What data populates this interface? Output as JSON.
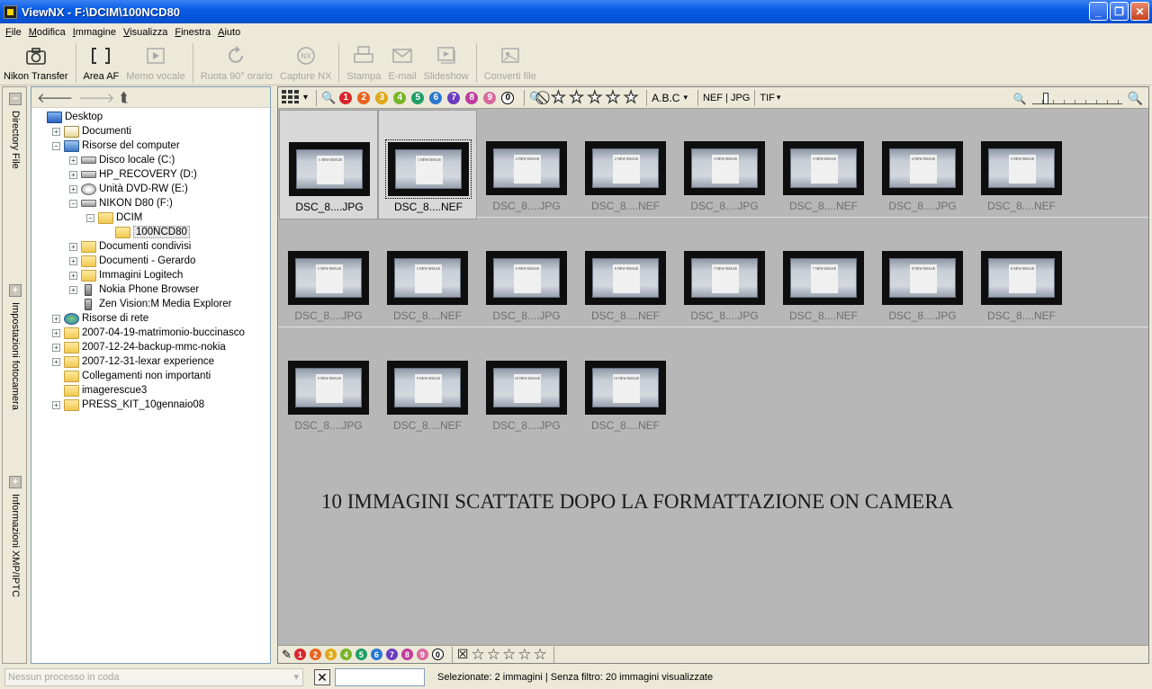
{
  "window": {
    "title": "ViewNX - F:\\DCIM\\100NCD80"
  },
  "menu": [
    "File",
    "Modifica",
    "Immagine",
    "Visualizza",
    "Finestra",
    "Aiuto"
  ],
  "toolbar": [
    {
      "label": "Nikon Transfer",
      "icon": "camera-icon",
      "enabled": true
    },
    {
      "label": "Area AF",
      "icon": "af-brackets-icon",
      "enabled": true
    },
    {
      "label": "Memo vocale",
      "icon": "play-icon",
      "enabled": false
    },
    {
      "label": "Ruota 90° orario",
      "icon": "rotate-icon",
      "enabled": false
    },
    {
      "label": "Capture NX",
      "icon": "capture-nx-icon",
      "enabled": false
    },
    {
      "label": "Stampa",
      "icon": "print-icon",
      "enabled": false
    },
    {
      "label": "E-mail",
      "icon": "mail-icon",
      "enabled": false
    },
    {
      "label": "Slideshow",
      "icon": "slideshow-icon",
      "enabled": false
    },
    {
      "label": "Converti file",
      "icon": "convert-icon",
      "enabled": false
    }
  ],
  "side_tabs": [
    "Directory File",
    "Impostazioni fotocamera",
    "Informazioni XMP/IPTC"
  ],
  "tree": [
    {
      "label": "Desktop",
      "level": 0,
      "icon": "desk",
      "exp": ""
    },
    {
      "label": "Documenti",
      "level": 1,
      "icon": "docs",
      "exp": "+"
    },
    {
      "label": "Risorse del computer",
      "level": 1,
      "icon": "comp",
      "exp": "-"
    },
    {
      "label": "Disco locale (C:)",
      "level": 2,
      "icon": "drive",
      "exp": "+"
    },
    {
      "label": "HP_RECOVERY (D:)",
      "level": 2,
      "icon": "drive",
      "exp": "+"
    },
    {
      "label": "Unità DVD-RW (E:)",
      "level": 2,
      "icon": "dvd",
      "exp": "+"
    },
    {
      "label": "NIKON D80 (F:)",
      "level": 2,
      "icon": "drive",
      "exp": "-"
    },
    {
      "label": "DCIM",
      "level": 3,
      "icon": "folder",
      "exp": "-"
    },
    {
      "label": "100NCD80",
      "level": 4,
      "icon": "folder",
      "exp": "",
      "selected": true
    },
    {
      "label": "Documenti condivisi",
      "level": 2,
      "icon": "folder",
      "exp": "+"
    },
    {
      "label": "Documenti - Gerardo",
      "level": 2,
      "icon": "folder",
      "exp": "+"
    },
    {
      "label": "Immagini Logitech",
      "level": 2,
      "icon": "folder",
      "exp": "+"
    },
    {
      "label": "Nokia Phone Browser",
      "level": 2,
      "icon": "phone",
      "exp": "+"
    },
    {
      "label": "Zen Vision:M Media Explorer",
      "level": 2,
      "icon": "phone",
      "exp": ""
    },
    {
      "label": "Risorse di rete",
      "level": 1,
      "icon": "net",
      "exp": "+"
    },
    {
      "label": "2007-04-19-matrimonio-buccinasco",
      "level": 1,
      "icon": "folder",
      "exp": "+"
    },
    {
      "label": "2007-12-24-backup-mmc-nokia",
      "level": 1,
      "icon": "folder",
      "exp": "+"
    },
    {
      "label": "2007-12-31-lexar experience",
      "level": 1,
      "icon": "folder",
      "exp": "+"
    },
    {
      "label": "Collegamenti non importanti",
      "level": 1,
      "icon": "folder",
      "exp": ""
    },
    {
      "label": "imagerescue3",
      "level": 1,
      "icon": "folder",
      "exp": ""
    },
    {
      "label": "PRESS_KIT_10gennaio08",
      "level": 1,
      "icon": "folder",
      "exp": "+"
    }
  ],
  "label_colors": [
    "#d8262c",
    "#e8641e",
    "#e0a818",
    "#78b428",
    "#1e9e68",
    "#2a78d0",
    "#6a3cc0",
    "#c03c9c",
    "#d86aa0"
  ],
  "label_numbers": [
    "1",
    "2",
    "3",
    "4",
    "5",
    "6",
    "7",
    "8",
    "9",
    "0"
  ],
  "filter": {
    "abc": "A.B.C",
    "formats": "NEF | JPG",
    "tif": "TIF"
  },
  "thumbnails": [
    {
      "caption": "DSC_8....JPG",
      "paper": "1 NEW IMAGE",
      "selected": true
    },
    {
      "caption": "DSC_8....NEF",
      "paper": "1 NEW IMAGE",
      "selected": true,
      "focus": true
    },
    {
      "caption": "DSC_8....JPG",
      "paper": "2 NEW IMAGE"
    },
    {
      "caption": "DSC_8....NEF",
      "paper": "2 NEW IMAGE"
    },
    {
      "caption": "DSC_8....JPG",
      "paper": "3 NEW IMAGE"
    },
    {
      "caption": "DSC_8....NEF",
      "paper": "3 NEW IMAGE"
    },
    {
      "caption": "DSC_8....JPG",
      "paper": "4 NEW IMAGE"
    },
    {
      "caption": "DSC_8....NEF",
      "paper": "4 NEW IMAGE"
    },
    {
      "caption": "DSC_8....JPG",
      "paper": "5 NEW IMAGE"
    },
    {
      "caption": "DSC_8....NEF",
      "paper": "5 NEW IMAGE"
    },
    {
      "caption": "DSC_8....JPG",
      "paper": "6 NEW IMAGE"
    },
    {
      "caption": "DSC_8....NEF",
      "paper": "6 NEW IMAGE"
    },
    {
      "caption": "DSC_8....JPG",
      "paper": "7 NEW IMAGE"
    },
    {
      "caption": "DSC_8....NEF",
      "paper": "7 NEW IMAGE"
    },
    {
      "caption": "DSC_8....JPG",
      "paper": "8 NEW IMAGE"
    },
    {
      "caption": "DSC_8....NEF",
      "paper": "8 NEW IMAGE"
    },
    {
      "caption": "DSC_8....JPG",
      "paper": "9 NEW IMAGE"
    },
    {
      "caption": "DSC_8....NEF",
      "paper": "9 NEW IMAGE"
    },
    {
      "caption": "DSC_8....JPG",
      "paper": "10 NEW IMAGE"
    },
    {
      "caption": "DSC_8....NEF",
      "paper": "10 NEW IMAGE"
    }
  ],
  "overlay_text": "10 IMMAGINI SCATTATE DOPO LA FORMATTAZIONE ON CAMERA",
  "status": {
    "queue": "Nessun processo in coda",
    "info": "Selezionate: 2 immagini | Senza filtro: 20 immagini visualizzate"
  }
}
